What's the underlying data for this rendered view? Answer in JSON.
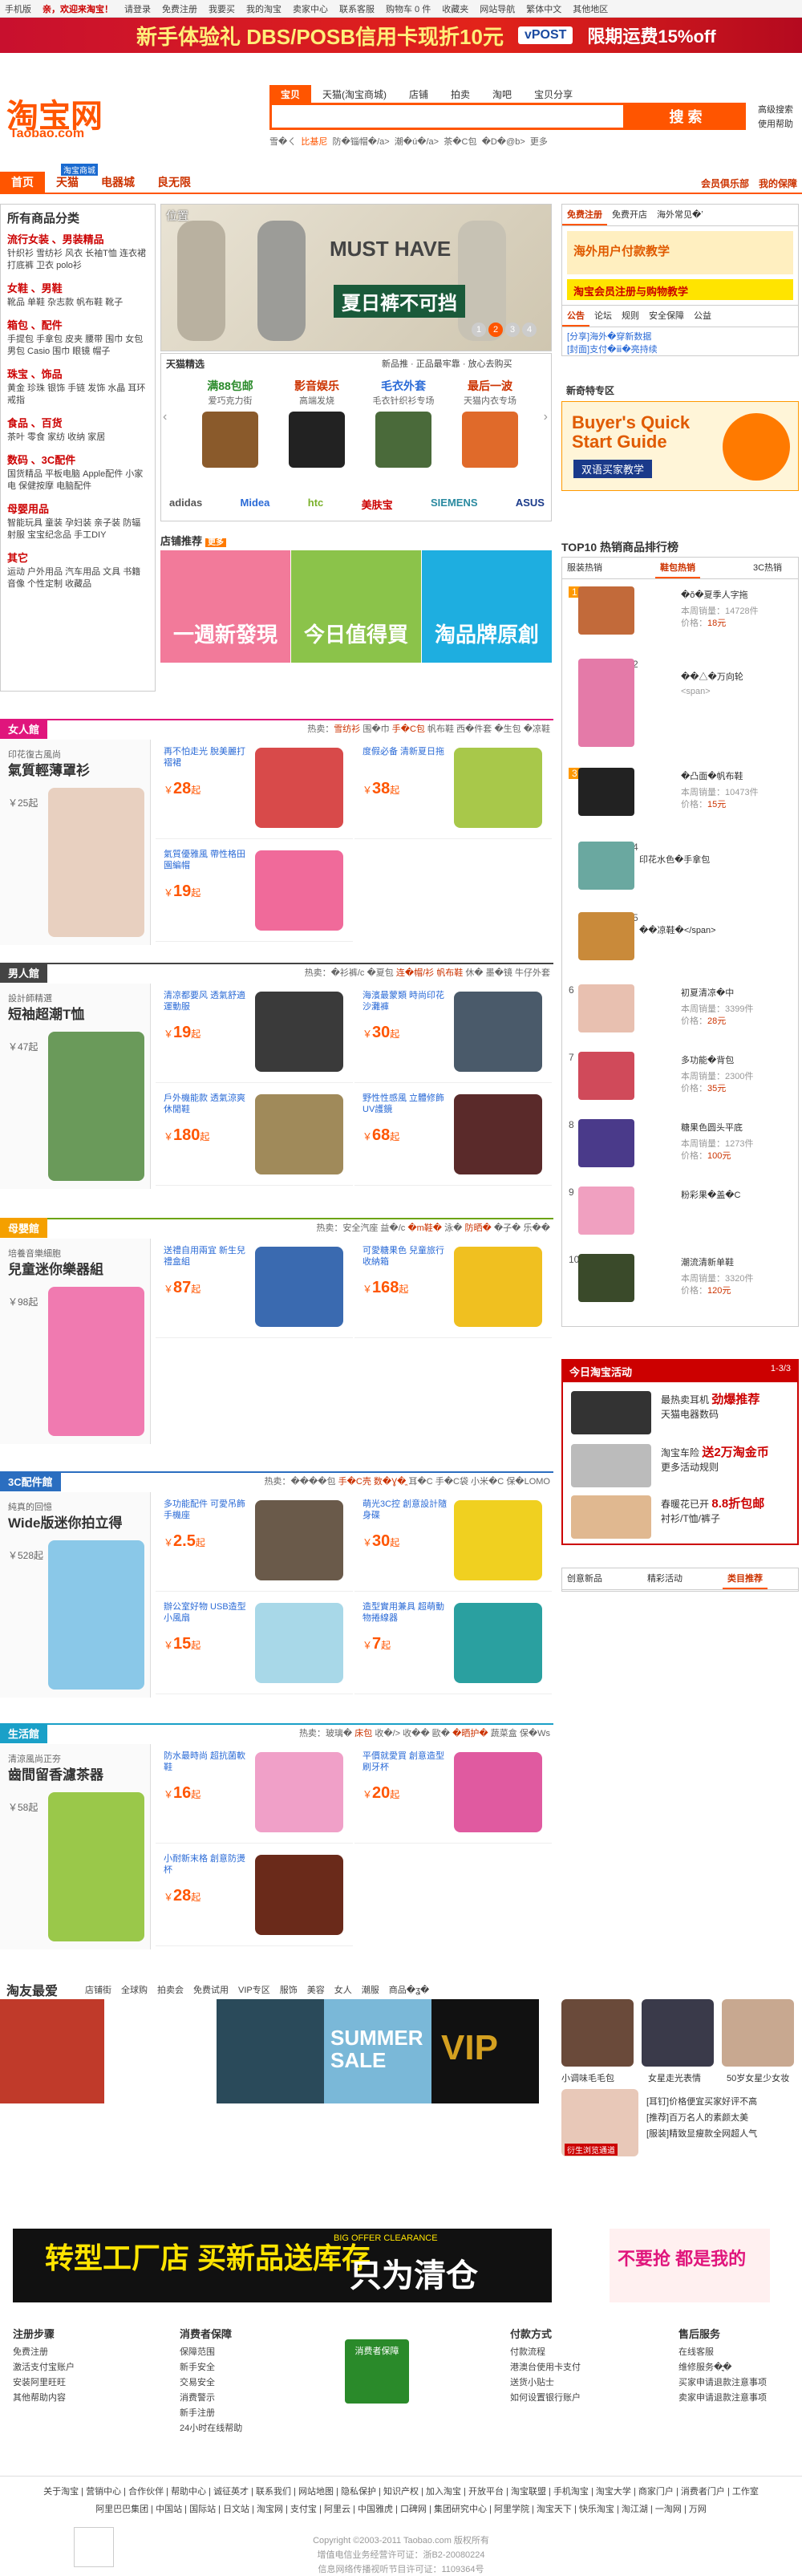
{
  "topbar": {
    "links": [
      "手机版",
      "亲，欢迎来淘宝！",
      "请登录",
      "免费注册",
      "我要买",
      "我的淘宝",
      "卖家中心",
      "联系客服",
      "购物车 0 件",
      "收藏夹",
      "网站导航",
      "繁体中文",
      "其他地区"
    ]
  },
  "banner": {
    "line1": "新手体验礼 DBS/POSB信用卡现折10元",
    "partner": "vPOST",
    "line2": "限期运费15%off"
  },
  "header": {
    "logo": "淘宝网",
    "logo_en": "Taobao.com",
    "search_tabs": [
      "宝贝",
      "天猫(淘宝商城)",
      "店铺",
      "拍卖",
      "淘吧",
      "宝贝分享"
    ],
    "search_button": "搜 索",
    "search_placeholder": "",
    "hot_words": [
      "雪�ㄑ",
      "比基尼",
      "防�锱帽�/a>",
      "潮�ú�/a>",
      "茶�C包",
      "�D�@b>",
      "更多"
    ],
    "right_links": [
      "高级搜索",
      "使用帮助"
    ]
  },
  "nav": {
    "tabs": [
      "首页",
      "天猫",
      "电器城",
      "良无限"
    ],
    "badge": "淘宝商城",
    "right": [
      "会员俱乐部",
      "我的保障"
    ]
  },
  "sidebar": {
    "title": "所有商品分类",
    "cats": [
      {
        "t": "流行女装 、男装精品",
        "l": "针织衫 雪纺衫 风衣 长袖T恤 连衣裙 打底裤 卫衣 polo衫"
      },
      {
        "t": "女鞋 、男鞋",
        "l": "靴品 单鞋 杂志款 帆布鞋 靴子"
      },
      {
        "t": "箱包 、配件",
        "l": "手提包 手拿包 皮夹 腰带 围巾 女包 男包 Casio 围巾 眼镜 帽子"
      },
      {
        "t": "珠宝 、饰品",
        "l": "黄金 珍珠 银饰 手链 发饰 水晶 耳环 戒指"
      },
      {
        "t": "食品 、百货",
        "l": "茶叶 零食 家纺 收纳 家居"
      },
      {
        "t": "数码 、3C配件",
        "l": "国货精品 平板电脑 Apple配件 小家电 保健按摩 电脑配件"
      },
      {
        "t": "母婴用品",
        "l": "智能玩具 童装 孕妇装 亲子装 防辐射服 宝宝纪念品 手工DIY"
      },
      {
        "t": "其它",
        "l": "运动 户外用品 汽车用品 文具 书籍 音像 个性定制 收藏品"
      }
    ]
  },
  "hero": {
    "pos": "位置",
    "must": "MUST HAVE",
    "tag": "夏日裤不可挡",
    "pages": [
      "1",
      "2",
      "3",
      "4"
    ]
  },
  "tmall": {
    "title": "天猫精选",
    "side": "新品推 · 正品最牢靠 · 放心去购买",
    "cells": [
      {
        "a": "满88包邮",
        "b": "爱巧克力街"
      },
      {
        "a": "影音娱乐",
        "b": "高端发烧"
      },
      {
        "a": "毛衣外套",
        "b": "毛衣针织衫专场"
      },
      {
        "a": "最后一波",
        "b": "天猫内衣专场"
      }
    ],
    "brands": [
      "adidas",
      "Midea",
      "htc",
      "美肤宝",
      "SIEMENS",
      "ASUS"
    ]
  },
  "shop": {
    "title": "店铺推荐",
    "more": "更多",
    "tiles": [
      "一週新發現",
      "今日值得買",
      "淘品牌原創"
    ]
  },
  "right_top": {
    "tabs": [
      "免费注册",
      "免费开店",
      "海外常见�ʽ"
    ],
    "ad1": "海外用户付款教学",
    "ad2": "淘宝会员注册与购物教学",
    "tabs2": [
      "公告",
      "论坛",
      "规则",
      "安全保障",
      "公益"
    ],
    "news": [
      "[分享]海外�穿新数据",
      "[封面]支付�ⅲ�亮持续"
    ],
    "hot_title": "新奇特专区",
    "buyers": "Buyer's Quick Start Guide",
    "buyers_cn": "双语买家教学"
  },
  "top10": {
    "title": "TOP10 热销商品排行榜",
    "tabs": [
      "服装热销",
      "鞋包热销",
      "3C热销"
    ],
    "items": [
      {
        "n": "1",
        "nm": "�ŏ�夏季人字拖",
        "sales": "本周销量：14728件",
        "price": "价格：",
        "pv": "18元"
      },
      {
        "n": "2",
        "nm": "��△�万向轮",
        "sales": "<span>",
        "price": "",
        "pv": ""
      },
      {
        "n": "3",
        "nm": "�凸面�帆布鞋",
        "sales": "本周销量：10473件",
        "price": "价格：",
        "pv": "15元"
      },
      {
        "n": "4",
        "nm": "印花水色�手拿包",
        "sales": "",
        "price": "",
        "pv": ""
      },
      {
        "n": "5",
        "nm": "��凉鞋�</span>",
        "sales": "",
        "price": "",
        "pv": ""
      },
      {
        "n": "6",
        "nm": "初夏清凉�中",
        "sales": "本周销量：3399件",
        "price": "价格：",
        "pv": "28元"
      },
      {
        "n": "7",
        "nm": "多功能�背包",
        "sales": "本周销量：2300件",
        "price": "价格：",
        "pv": "35元"
      },
      {
        "n": "8",
        "nm": "糖果色圆头平底",
        "sales": "本周销量：1273件",
        "price": "价格：",
        "pv": "100元"
      },
      {
        "n": "9",
        "nm": "粉彩果�盖�C",
        "sales": "",
        "price": "",
        "pv": ""
      },
      {
        "n": "10",
        "nm": "潮流清新单鞋",
        "sales": "本周销量：3320件",
        "price": "价格：",
        "pv": "120元"
      }
    ]
  },
  "activity": {
    "title": "今日淘宝活动",
    "page": "1-3/3",
    "rows": [
      {
        "a": "最热卖耳机",
        "b": "劲爆推荐",
        "c": "天猫电器数码"
      },
      {
        "a": "淘宝车险",
        "b": "送2万淘金币",
        "c": "更多活动规则"
      },
      {
        "a": "春暖花已开",
        "b": "8.8折包邮",
        "c": "衬衫/T恤/裤子"
      }
    ]
  },
  "right_bottom_tabs": [
    "创意新品",
    "精彩活动",
    "类目推荐"
  ],
  "floors": [
    {
      "tag": "女人館",
      "color": "#e0157c",
      "hot": "热卖：",
      "hots": [
        "雪纺衫",
        "围�巾",
        "手�C包",
        "帆布鞋",
        "西�件套",
        "�生包",
        "�凉鞋"
      ],
      "t1": "印花復古風尚",
      "t2": "氣質輕薄罩衫",
      "pr": "￥25起",
      "items": [
        {
          "d": "再不怕走光 脫美麗打褶裙",
          "p": "28",
          "u": "起"
        },
        {
          "d": "度假必备 清新夏日拖",
          "p": "38",
          "u": "起"
        },
        {
          "d": "氣質優雅風 帶性格田園編帽",
          "p": "19",
          "u": "起"
        }
      ]
    },
    {
      "tag": "男人館",
      "color": "#444",
      "hot": "热卖：",
      "hots": [
        "�衫裤/c",
        "�夏包",
        "连�帽/衫",
        "帆布鞋",
        "休�",
        "墨�镜",
        "牛仔外套"
      ],
      "t1": "設計師精選",
      "t2": "短袖超潮T恤",
      "pr": "￥47起",
      "items": [
        {
          "d": "清凉都要风 透氣舒適運動服",
          "p": "19",
          "u": "起"
        },
        {
          "d": "海濱最蒙類 時尚印花沙灘褲",
          "p": "30",
          "u": "起"
        },
        {
          "d": "戶外機能款 透氣涼爽休閒鞋",
          "p": "180",
          "u": "起"
        },
        {
          "d": "野性性感風 立體修飾UV護鏡",
          "p": "68",
          "u": "起"
        }
      ]
    },
    {
      "tag": "母嬰館",
      "color": "#6ca40a",
      "hot": "热卖：",
      "hots": [
        "安全汽座",
        "益�/c",
        "�m鞋�",
        "泳�",
        "防晒�",
        "�子�",
        "乐��"
      ],
      "t1": "培養音樂細胞",
      "t2": "兒童迷你樂器組",
      "pr": "￥98起",
      "items": [
        {
          "d": "送禮自用兩宜 新生兒禮盒組",
          "p": "87",
          "u": "起"
        },
        {
          "d": "可愛糖果色 兒童旅行收納箱",
          "p": "168",
          "u": "起"
        }
      ]
    },
    {
      "tag": "3C配件館",
      "color": "#2b6ec0",
      "hot": "热卖：",
      "hots": [
        "����包",
        "手�C壳",
        "数�Ɣ�ֱ",
        "耳�C",
        "手�C袋",
        "小米�C",
        "保�LOMO"
      ],
      "t1": "純真的回憶",
      "t2": "Wide版迷你拍立得",
      "pr": "￥528起",
      "items": [
        {
          "d": "多功能配件 可愛吊飾手機座",
          "p": "2.5",
          "u": "起"
        },
        {
          "d": "萌光3C控 創意設計隨身碟",
          "p": "30",
          "u": "起"
        },
        {
          "d": "辦公室好物 USB造型小風扇",
          "p": "15",
          "u": "起"
        },
        {
          "d": "造型實用兼具 超萌動物捲線器",
          "p": "7",
          "u": "起"
        }
      ]
    },
    {
      "tag": "生活館",
      "color": "#1aa0c8",
      "hot": "热卖：",
      "hots": [
        "玻璃�",
        "床包",
        "收�/>",
        "收��",
        "歐�",
        "�晒护�",
        "蔬菜盒",
        "保�Ws"
      ],
      "t1": "清涼風尚正夯",
      "t2": "齒間留香濾茶器",
      "pr": "￥58起",
      "items": [
        {
          "d": "防水最時尚 超抗菌軟鞋",
          "p": "16",
          "u": "起"
        },
        {
          "d": "平價就愛買 創意造型刷牙杯",
          "p": "20",
          "u": "起"
        },
        {
          "d": "小耐新末格 創意防燙杯",
          "p": "28",
          "u": "起"
        }
      ]
    }
  ],
  "taoyou": {
    "title": "淘友最爱",
    "links": [
      "店铺街",
      "全球购",
      "拍卖会",
      "免费试用",
      "VIP专区",
      "服饰",
      "美容",
      "女人",
      "潮服",
      "商品�ʓ�"
    ],
    "summer": "SUMMER SALE",
    "vip": "VIP",
    "people": [
      {
        "t": "小调味毛毛包"
      },
      {
        "t": "女星走光表情"
      },
      {
        "t": "50岁女星少女妆"
      }
    ],
    "news": [
      "[耳钉]价格便宜买家好评不高",
      "[推荐]百万名人的素颜太美",
      "[服装]精致显瘦款全网超人气"
    ],
    "quote": "衍生浏览通道"
  },
  "promo": {
    "a": "转型工厂店 买新品送库存",
    "tag": "BIG OFFER CLEARANCE",
    "b": "只为清仓",
    "right": "不要抢 都是我的"
  },
  "footer": {
    "cols": [
      {
        "h": "注册步骤",
        "l": [
          "免费注册",
          "激活支付宝账户",
          "安装阿里旺旺",
          "其他帮助内容"
        ]
      },
      {
        "h": "消费者保障",
        "l": [
          "保障范围",
          "新手安全",
          "交易安全",
          "消费警示",
          "新手注册",
          "24小时在线帮助"
        ]
      },
      {
        "h": "付款方式",
        "l": [
          "付款流程",
          "港澳台使用卡支付",
          "送货小贴士",
          "如何设置银行账户"
        ]
      },
      {
        "h": "售后服务",
        "l": [
          "在线客服",
          "维修服务�ֳֶ�",
          "买家申请退款注意事项",
          "卖家申请退款注意事项"
        ]
      }
    ],
    "badge": "消费者保障",
    "links1": [
      "关于淘宝",
      "营销中心",
      "合作伙伴",
      "帮助中心",
      "诚征英才",
      "联系我们",
      "网站地图",
      "隐私保护",
      "知识产权",
      "加入淘宝",
      "开放平台",
      "淘宝联盟",
      "手机淘宝",
      "淘宝大学",
      "商家门户",
      "消费者门户",
      "工作室"
    ],
    "links2": [
      "阿里巴巴集团",
      "中国站",
      "国际站",
      "日文站",
      "淘宝网",
      "支付宝",
      "阿里云",
      "中国雅虎",
      "口碑网",
      "集团研究中心",
      "阿里学院",
      "淘宝天下",
      "快乐淘宝",
      "淘江湖",
      "一淘网",
      "万网"
    ],
    "copy1": "Copyright ©2003-2011 Taobao.com 版权所有",
    "copy2": "增值电信业务经营许可证：浙B2-20080224",
    "copy3": "信息网络传播视听节目许可证：1109364号"
  }
}
